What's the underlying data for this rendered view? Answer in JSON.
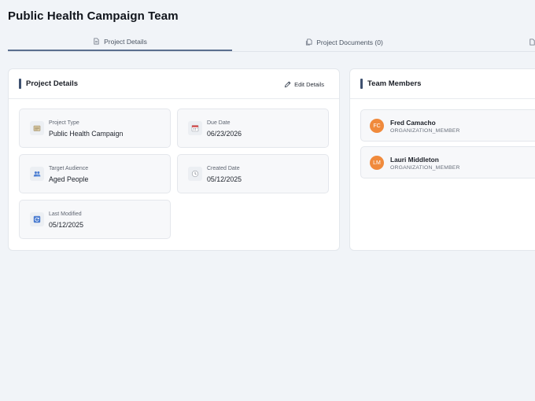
{
  "header": {
    "title": "Public Health Campaign Team"
  },
  "tabs": [
    {
      "label": "Project Details",
      "icon": "document-icon"
    },
    {
      "label": "Project Documents (0)",
      "icon": "documents-icon"
    }
  ],
  "details": {
    "title": "Project Details",
    "edit_label": "Edit Details",
    "fields": {
      "project_type": {
        "label": "Project Type",
        "value": "Public Health Campaign"
      },
      "due_date": {
        "label": "Due Date",
        "value": "06/23/2026"
      },
      "target_audience": {
        "label": "Target Audience",
        "value": "Aged People"
      },
      "created_date": {
        "label": "Created Date",
        "value": "05/12/2025"
      },
      "last_modified": {
        "label": "Last Modified",
        "value": "05/12/2025"
      }
    }
  },
  "team": {
    "title": "Team Members",
    "members": [
      {
        "initials": "FC",
        "name": "Fred Camacho",
        "role": "ORGANIZATION_MEMBER"
      },
      {
        "initials": "LM",
        "name": "Lauri Middleton",
        "role": "ORGANIZATION_MEMBER"
      }
    ]
  },
  "colors": {
    "background": "#f1f4f8",
    "accent": "#3f5170",
    "avatar": "#f08a3c"
  }
}
